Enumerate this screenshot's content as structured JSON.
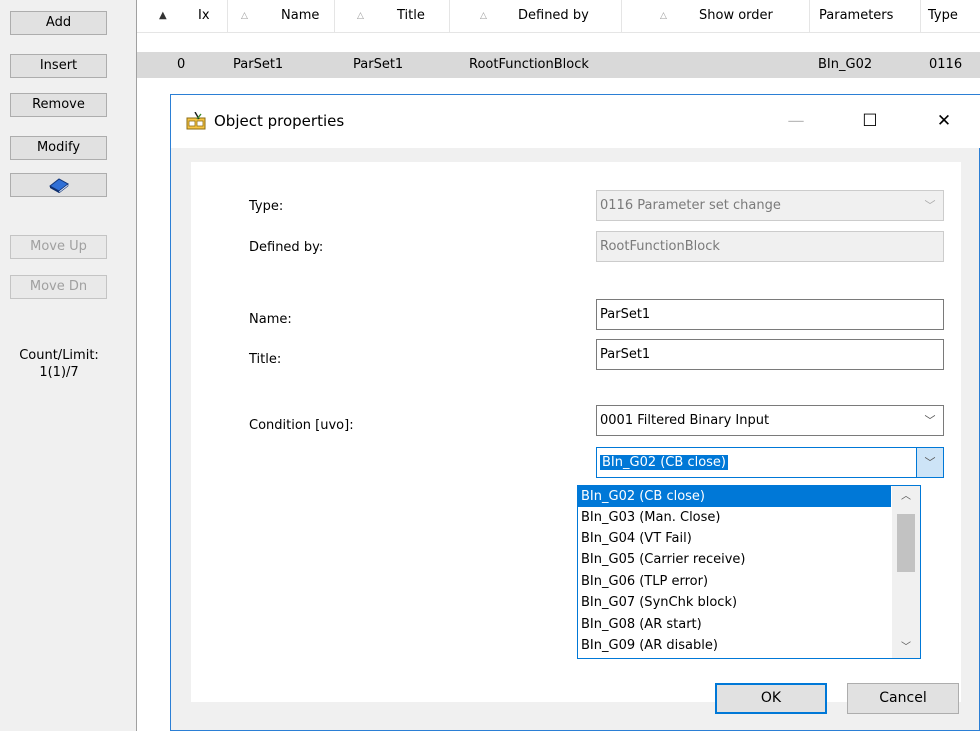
{
  "sidebar": {
    "add": "Add",
    "insert": "Insert",
    "remove": "Remove",
    "modify": "Modify",
    "move_up": "Move Up",
    "move_dn": "Move Dn",
    "count_label": "Count/Limit:",
    "count_value": "1(1)/7"
  },
  "grid": {
    "columns": [
      "Ix",
      "Name",
      "Title",
      "Defined by",
      "Show order",
      "Parameters",
      "Type"
    ],
    "rows": [
      {
        "ix": "0",
        "name": "ParSet1",
        "title": "ParSet1",
        "defined_by": "RootFunctionBlock",
        "show_order": "",
        "parameters": "BIn_G02",
        "type": "0116"
      }
    ]
  },
  "dialog": {
    "title": "Object properties",
    "labels": {
      "type": "Type:",
      "defined_by": "Defined by:",
      "name": "Name:",
      "title": "Title:",
      "condition": "Condition [uvo]:"
    },
    "values": {
      "type": "0116  Parameter set change",
      "defined_by": "RootFunctionBlock",
      "name": "ParSet1",
      "title": "ParSet1",
      "condition": "0001  Filtered Binary Input",
      "selected_param": "BIn_G02 (CB close)"
    },
    "dropdown_items": [
      "BIn_G02 (CB close)",
      "BIn_G03 (Man. Close)",
      "BIn_G04 (VT Fail)",
      "BIn_G05 (Carrier receive)",
      "BIn_G06 (TLP error)",
      "BIn_G07 (SynChk block)",
      "BIn_G08 (AR start)",
      "BIn_G09 (AR disable)"
    ],
    "ok": "OK",
    "cancel": "Cancel"
  },
  "colors": {
    "accent": "#0078d7",
    "selected_row": "#d9d9d9"
  }
}
